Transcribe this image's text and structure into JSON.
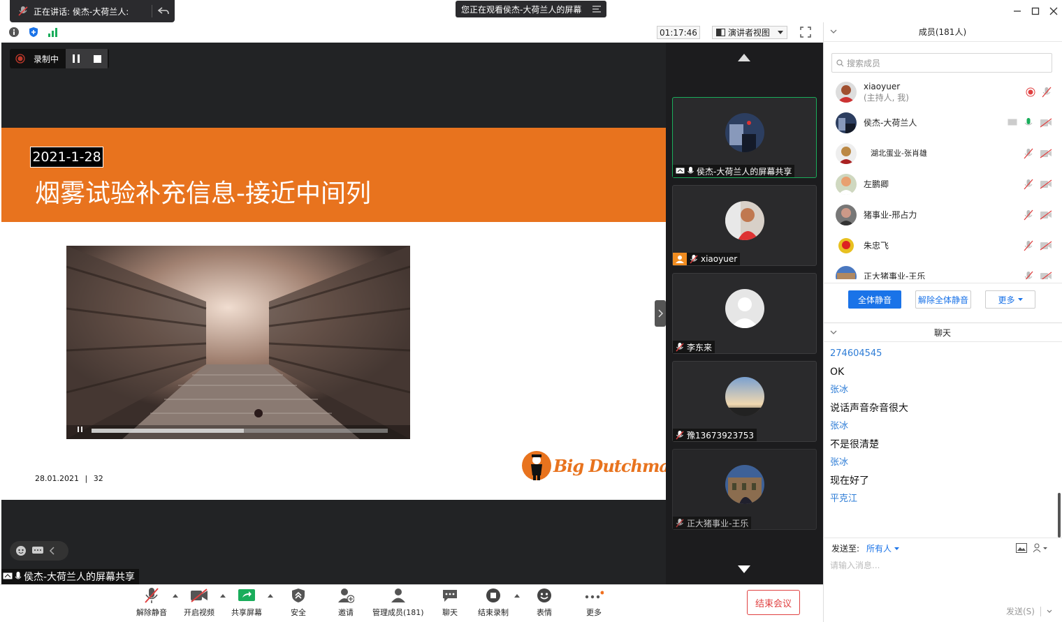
{
  "titlebar": {
    "speaking_label": "正在讲话: 侯杰-大荷兰人:",
    "viewing_label": "您正在观看侯杰-大荷兰人的屏幕"
  },
  "toolbar": {
    "timer": "01:17:46",
    "view_mode": "演讲者视图"
  },
  "recording": {
    "label": "录制中"
  },
  "slide": {
    "date_box": "2021-1-28",
    "title": "烟雾试验补充信息-接近中间列",
    "footer_date": "28.01.2021",
    "footer_page": "32",
    "logo_text": "Big Dutchman"
  },
  "share_label": "侯杰-大荷兰人的屏幕共享",
  "gallery": [
    {
      "name": "侯杰-大荷兰人的屏幕共享",
      "active": true
    },
    {
      "name": "xiaoyuer",
      "active": false
    },
    {
      "name": "李东来",
      "active": false
    },
    {
      "name": "豫13673923753",
      "active": false
    },
    {
      "name": "正大猪事业-王乐",
      "active": false
    }
  ],
  "bottom": {
    "unmute": "解除静音",
    "video": "开启视频",
    "share": "共享屏幕",
    "security": "安全",
    "invite": "邀请",
    "manage": "管理成员(181)",
    "chat": "聊天",
    "stop_rec": "结束录制",
    "reactions": "表情",
    "more": "更多",
    "end_meeting": "结束会议"
  },
  "panel": {
    "members_title": "成员(181人)",
    "search_placeholder": "搜索成员",
    "members": [
      {
        "name": "xiaoyuer",
        "sub": "(主持人, 我)"
      },
      {
        "name": "侯杰-大荷兰人",
        "sub": ""
      },
      {
        "name": "湖北蛋业-张肖雄",
        "sub": ""
      },
      {
        "name": "左鹏卿",
        "sub": ""
      },
      {
        "name": "猪事业-邢占力",
        "sub": ""
      },
      {
        "name": "朱忠飞",
        "sub": ""
      },
      {
        "name": "正大猪事业-王乐",
        "sub": ""
      }
    ],
    "mute_all": "全体静音",
    "unmute_all": "解除全体静音",
    "more": "更多",
    "chat_title": "聊天",
    "chat": [
      {
        "type": "name",
        "text": "274604545"
      },
      {
        "type": "msg",
        "text": "OK"
      },
      {
        "type": "name",
        "text": "张冰"
      },
      {
        "type": "msg",
        "text": "说话声音杂音很大"
      },
      {
        "type": "name",
        "text": "张冰"
      },
      {
        "type": "msg",
        "text": "不是很清楚"
      },
      {
        "type": "name",
        "text": "张冰"
      },
      {
        "type": "msg",
        "text": "现在好了"
      },
      {
        "type": "name",
        "text": "平克江"
      }
    ],
    "send_to_label": "发送至:",
    "send_to_value": "所有人",
    "input_placeholder": "请输入消息...",
    "send_button": "发送(S)"
  },
  "colors": {
    "accent": "#1a73e8",
    "slide_orange": "#e8731e",
    "end_red": "#e04040",
    "active_tile": "#1aad5b"
  }
}
